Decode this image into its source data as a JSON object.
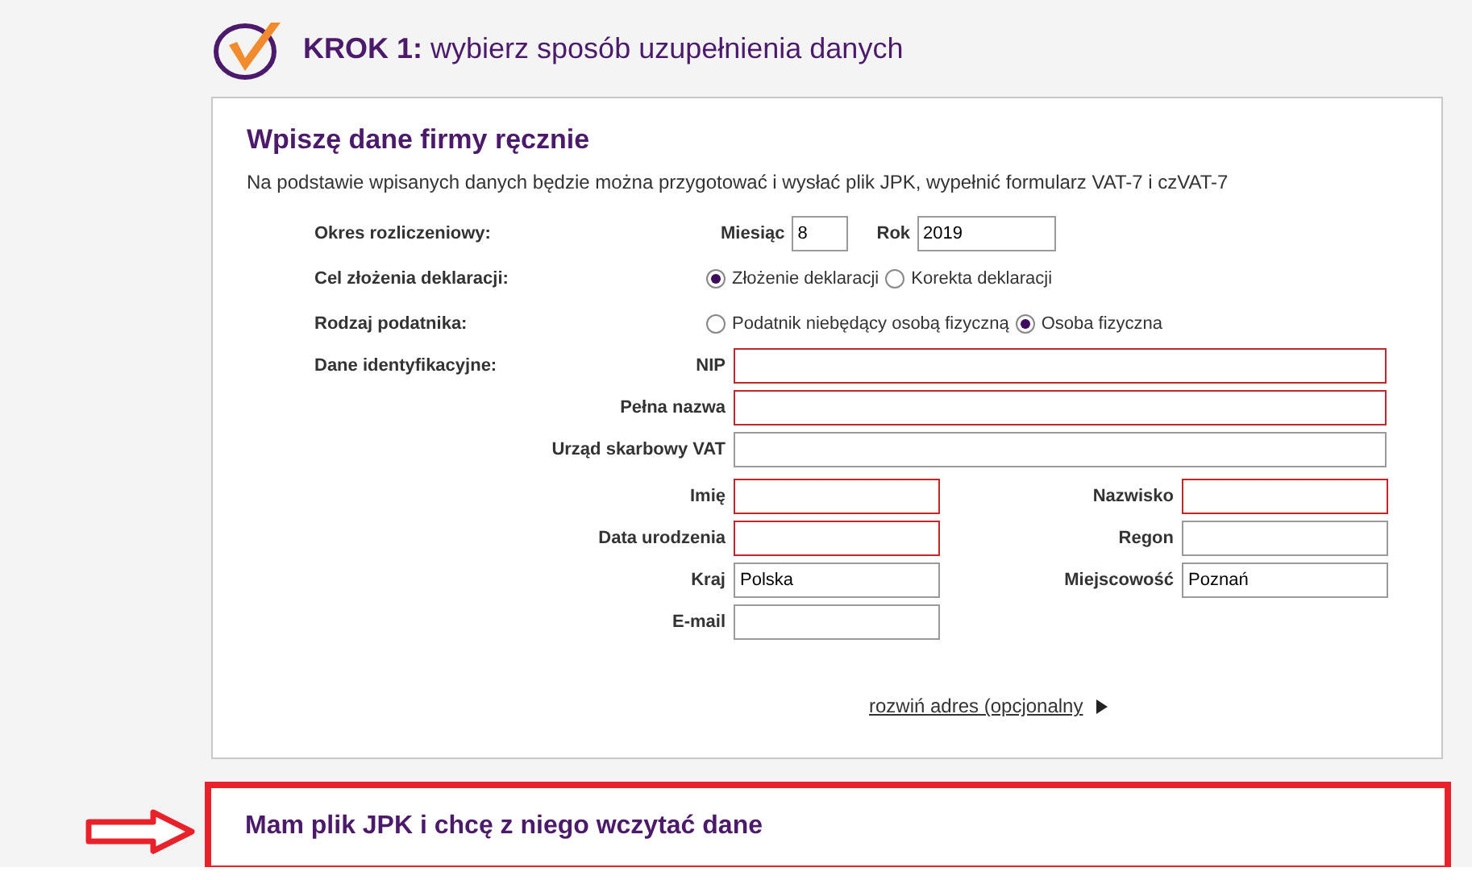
{
  "header": {
    "title": "**KROK 1:** wybierz sposób uzupełnienia danych"
  },
  "manual_section": {
    "title": "Wpiszę dane firmy ręcznie",
    "description": "Na podstawie wpisanych danych będzie można przygotować i wysłać plik JPK, wypełnić formularz VAT-7 i czVAT-7",
    "period": {
      "label": "Okres rozliczeniowy:",
      "month": {
        "label": "Miesiąc",
        "value": "8"
      },
      "year": {
        "label": "Rok",
        "value": "2019"
      }
    },
    "purpose": {
      "label": "Cel złożenia deklaracji:",
      "options": [
        {
          "label": "Złożenie deklaracji",
          "selected": true
        },
        {
          "label": "Korekta deklaracji",
          "selected": false
        }
      ]
    },
    "taxpayer_type": {
      "label": "Rodzaj podatnika:",
      "options": [
        {
          "label": "Podatnik niebędący osobą fizyczną",
          "selected": false
        },
        {
          "label": "Osoba fizyczna",
          "selected": true
        }
      ]
    },
    "identification": {
      "label": "Dane identyfikacyjne:",
      "rows": [
        {
          "kind": "wide",
          "fields": [
            {
              "label": "NIP",
              "error": true
            }
          ]
        },
        {
          "kind": "wide",
          "fields": [
            {
              "label": "Pełna nazwa",
              "error": true
            }
          ]
        },
        {
          "kind": "wide",
          "fields": [
            {
              "label": "Urząd skarbowy VAT",
              "error": false
            }
          ]
        },
        {
          "kind": "narrow",
          "fields": [
            {
              "label": "Imię",
              "error": true
            },
            {
              "label": "Nazwisko",
              "error": true
            }
          ]
        },
        {
          "kind": "narrow",
          "fields": [
            {
              "label": "Data urodzenia",
              "error": true
            },
            {
              "label": "Regon",
              "error": false
            }
          ]
        },
        {
          "kind": "narrow",
          "fields": [
            {
              "label": "Kraj",
              "value": "Polska",
              "error": false
            },
            {
              "label": "Miejscowość",
              "value": "Poznań",
              "error": false
            }
          ]
        },
        {
          "kind": "narrow",
          "fields": [
            {
              "label": "E-mail",
              "error": false
            }
          ]
        }
      ]
    },
    "expand_link": "rozwiń adres (opcjonalny"
  },
  "file_section": {
    "title": "Mam plik JPK i chcę z niego wczytać dane"
  }
}
